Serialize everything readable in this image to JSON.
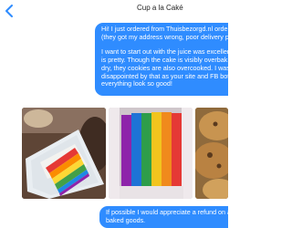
{
  "header": {
    "title": "Cup a la Caké",
    "back_icon": "chevron-left-icon"
  },
  "messages": {
    "first": {
      "line1": "Hi! I just ordered from Thuisbezorgd.nl order",
      "line2": "(they got my address wrong, poor delivery p",
      "line3": "I want to start out with the juice was excellen",
      "line4": "is pretty.  Though the cake is visibly overbak",
      "line5": "dry, they cookies are also overcooked.  I was",
      "line6": "disappointed by that as your site and FB bott",
      "line7": "everything look so good!"
    },
    "second": {
      "line1": "If possible I would appreciate a refund on at",
      "line2": "baked goods."
    }
  },
  "photos": [
    "cake-slice-on-plate",
    "rainbow-cake-closeup",
    "cookies"
  ],
  "colors": {
    "bubble": "#2f8cff",
    "accent": "#2f8cff"
  }
}
